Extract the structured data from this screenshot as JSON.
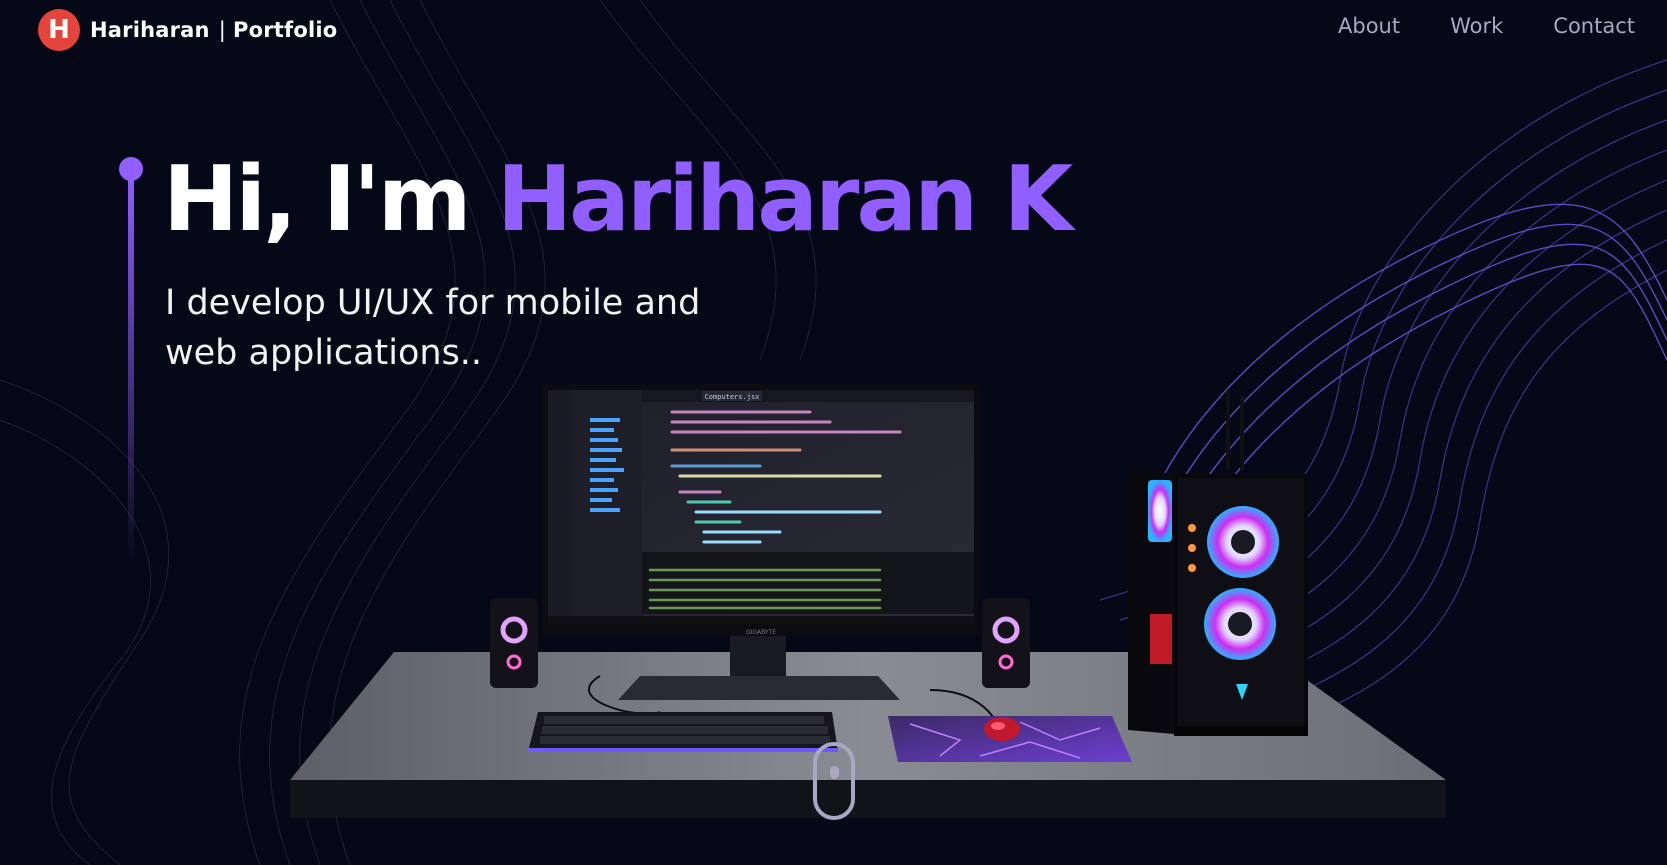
{
  "nav": {
    "logo_letter": "H",
    "brand_name": "Hariharan",
    "brand_separator": "|",
    "brand_suffix": "Portfolio",
    "links": [
      {
        "label": "About"
      },
      {
        "label": "Work"
      },
      {
        "label": "Contact"
      }
    ]
  },
  "hero": {
    "greeting": "Hi, I'm ",
    "name": "Hariharan K",
    "subtitle": "I develop UI/UX for mobile and web applications.."
  },
  "scene": {
    "monitor_brand": "GIGABYTE",
    "editor_tab": "Computers.jsx"
  },
  "colors": {
    "background": "#050816",
    "accent": "#915eff",
    "logo": "#e4443a",
    "nav_text": "#aaa6c3"
  }
}
